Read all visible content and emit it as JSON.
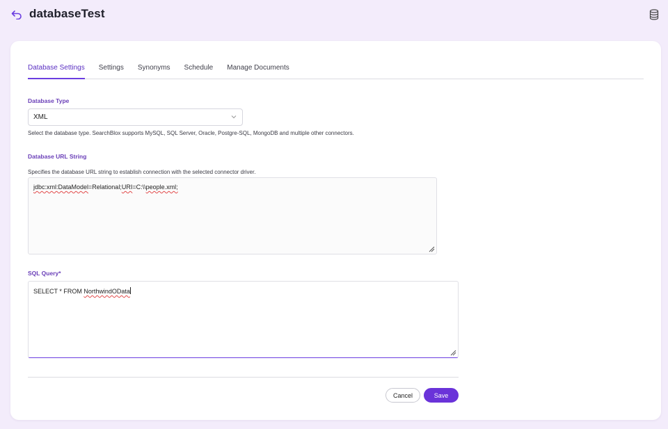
{
  "header": {
    "title": "databaseTest",
    "back_icon": "back-arrow-icon",
    "database_icon": "database-icon"
  },
  "tabs": [
    {
      "label": "Database Settings",
      "active": true
    },
    {
      "label": "Settings",
      "active": false
    },
    {
      "label": "Synonyms",
      "active": false
    },
    {
      "label": "Schedule",
      "active": false
    },
    {
      "label": "Manage Documents",
      "active": false
    }
  ],
  "database_type": {
    "label": "Database Type",
    "selected": "XML",
    "help": "Select the database type. SearchBlox supports MySQL, SQL Server, Oracle, Postgre-SQL, MongoDB and multiple other connectors."
  },
  "database_url": {
    "label": "Database URL String",
    "help": "Specifies the database URL string to establish connection with the selected connector driver.",
    "value_part1": "jdbc:xml:DataModel",
    "value_part2": "=Relational;",
    "value_part3": "URI",
    "value_part4": "=C:\\\\",
    "value_part5": "people.xml;"
  },
  "sql_query": {
    "label": "SQL Query*",
    "value_plain": "SELECT * FROM ",
    "value_flagged": "NorthwindOData"
  },
  "actions": {
    "cancel": "Cancel",
    "save": "Save"
  },
  "colors": {
    "accent": "#6a33d9",
    "background": "#f3ecfb",
    "label": "#6a3fb8"
  }
}
